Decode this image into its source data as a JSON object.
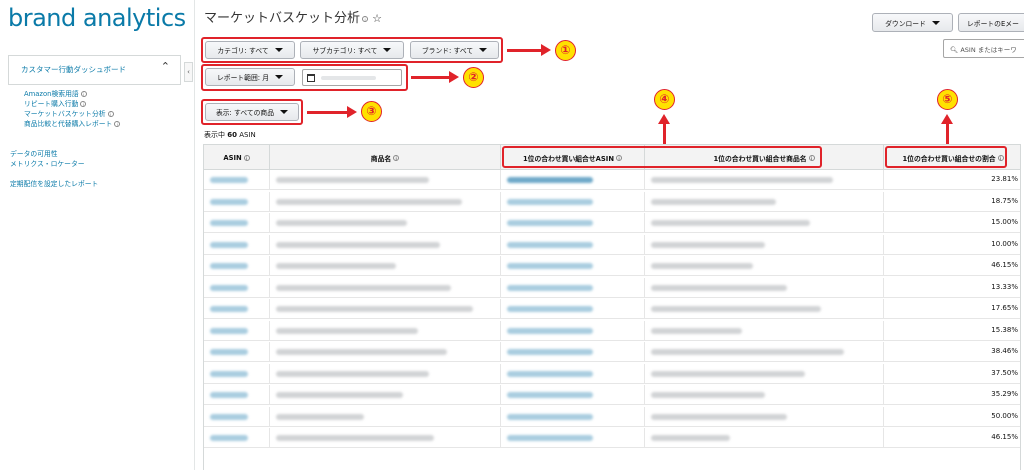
{
  "sidebar": {
    "logo": "brand analytics",
    "section": "カスタマー行動ダッシュボード",
    "items": [
      "Amazon検索用語",
      "リピート購入行動",
      "マーケットバスケット分析",
      "商品比較と代替購入レポート"
    ],
    "links": [
      "データの可用性",
      "メトリクス・ロケーター",
      "定期配信を設定したレポート"
    ]
  },
  "header": {
    "title": "マーケットバスケット分析",
    "download": "ダウンロード",
    "email": "レポートのEメー",
    "search_placeholder": "ASIN またはキーワ"
  },
  "filters": {
    "category": "カテゴリ: すべて",
    "subcategory": "サブカテゴリ: すべて",
    "brand": "ブランド: すべて",
    "range": "レポート範囲: 月",
    "display": "表示: すべての商品"
  },
  "annotations": [
    "①",
    "②",
    "③",
    "④",
    "⑤"
  ],
  "count": {
    "prefix": "表示中",
    "value": "60",
    "suffix": "ASIN"
  },
  "table": {
    "columns": [
      "ASIN",
      "商品名",
      "1位の合わせ買い組合せASIN",
      "1位の合わせ買い組合せ商品名",
      "1位の合わせ買い組合せの割合"
    ],
    "percentages": [
      "23.81%",
      "18.75%",
      "15.00%",
      "10.00%",
      "46.15%",
      "13.33%",
      "17.65%",
      "15.38%",
      "38.46%",
      "37.50%",
      "35.29%",
      "50.00%",
      "46.15%"
    ]
  },
  "colors": {
    "link": "#0a7aa8",
    "annotation": "#e0232a",
    "badge": "#ffe100"
  }
}
